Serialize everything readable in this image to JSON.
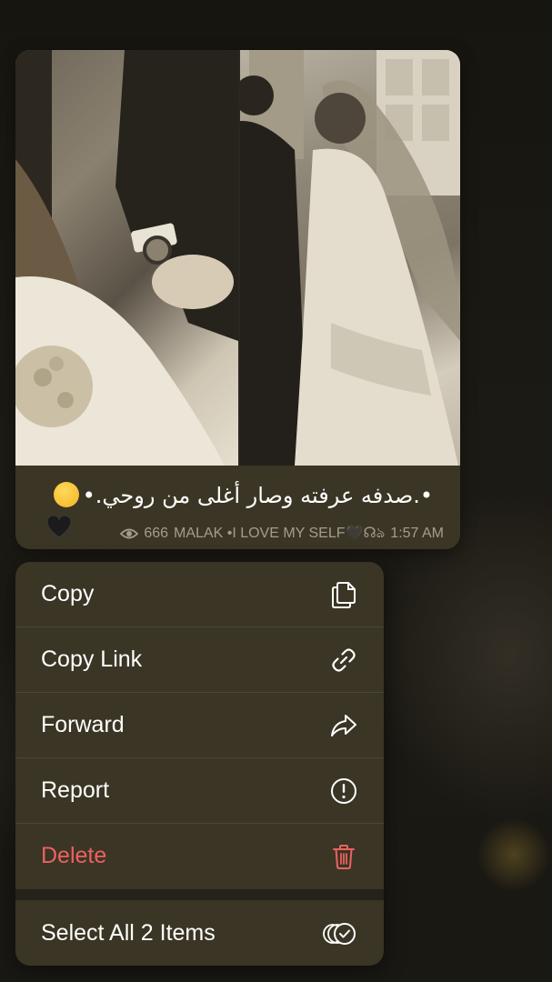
{
  "message": {
    "caption": "•.صدفه عرفته وصار أغلى من روحي.•",
    "views": "666",
    "author": "MALAK •I LOVE MY SELF🖤☊ঌ",
    "time": "1:57 AM",
    "icons": {
      "caption_emoji": "drooling-face-emoji",
      "heart": "black-heart-emoji",
      "views": "eye-icon"
    }
  },
  "menu": {
    "items": [
      {
        "label": "Copy",
        "icon": "copy-icon"
      },
      {
        "label": "Copy Link",
        "icon": "link-icon"
      },
      {
        "label": "Forward",
        "icon": "forward-arrow-icon"
      },
      {
        "label": "Report",
        "icon": "exclamation-circle-icon"
      },
      {
        "label": "Delete",
        "icon": "trash-icon"
      },
      {
        "label": "Select All 2 Items",
        "icon": "select-all-check-icon"
      }
    ],
    "colors": {
      "background": "#3a3524",
      "danger": "#ec6161"
    }
  }
}
